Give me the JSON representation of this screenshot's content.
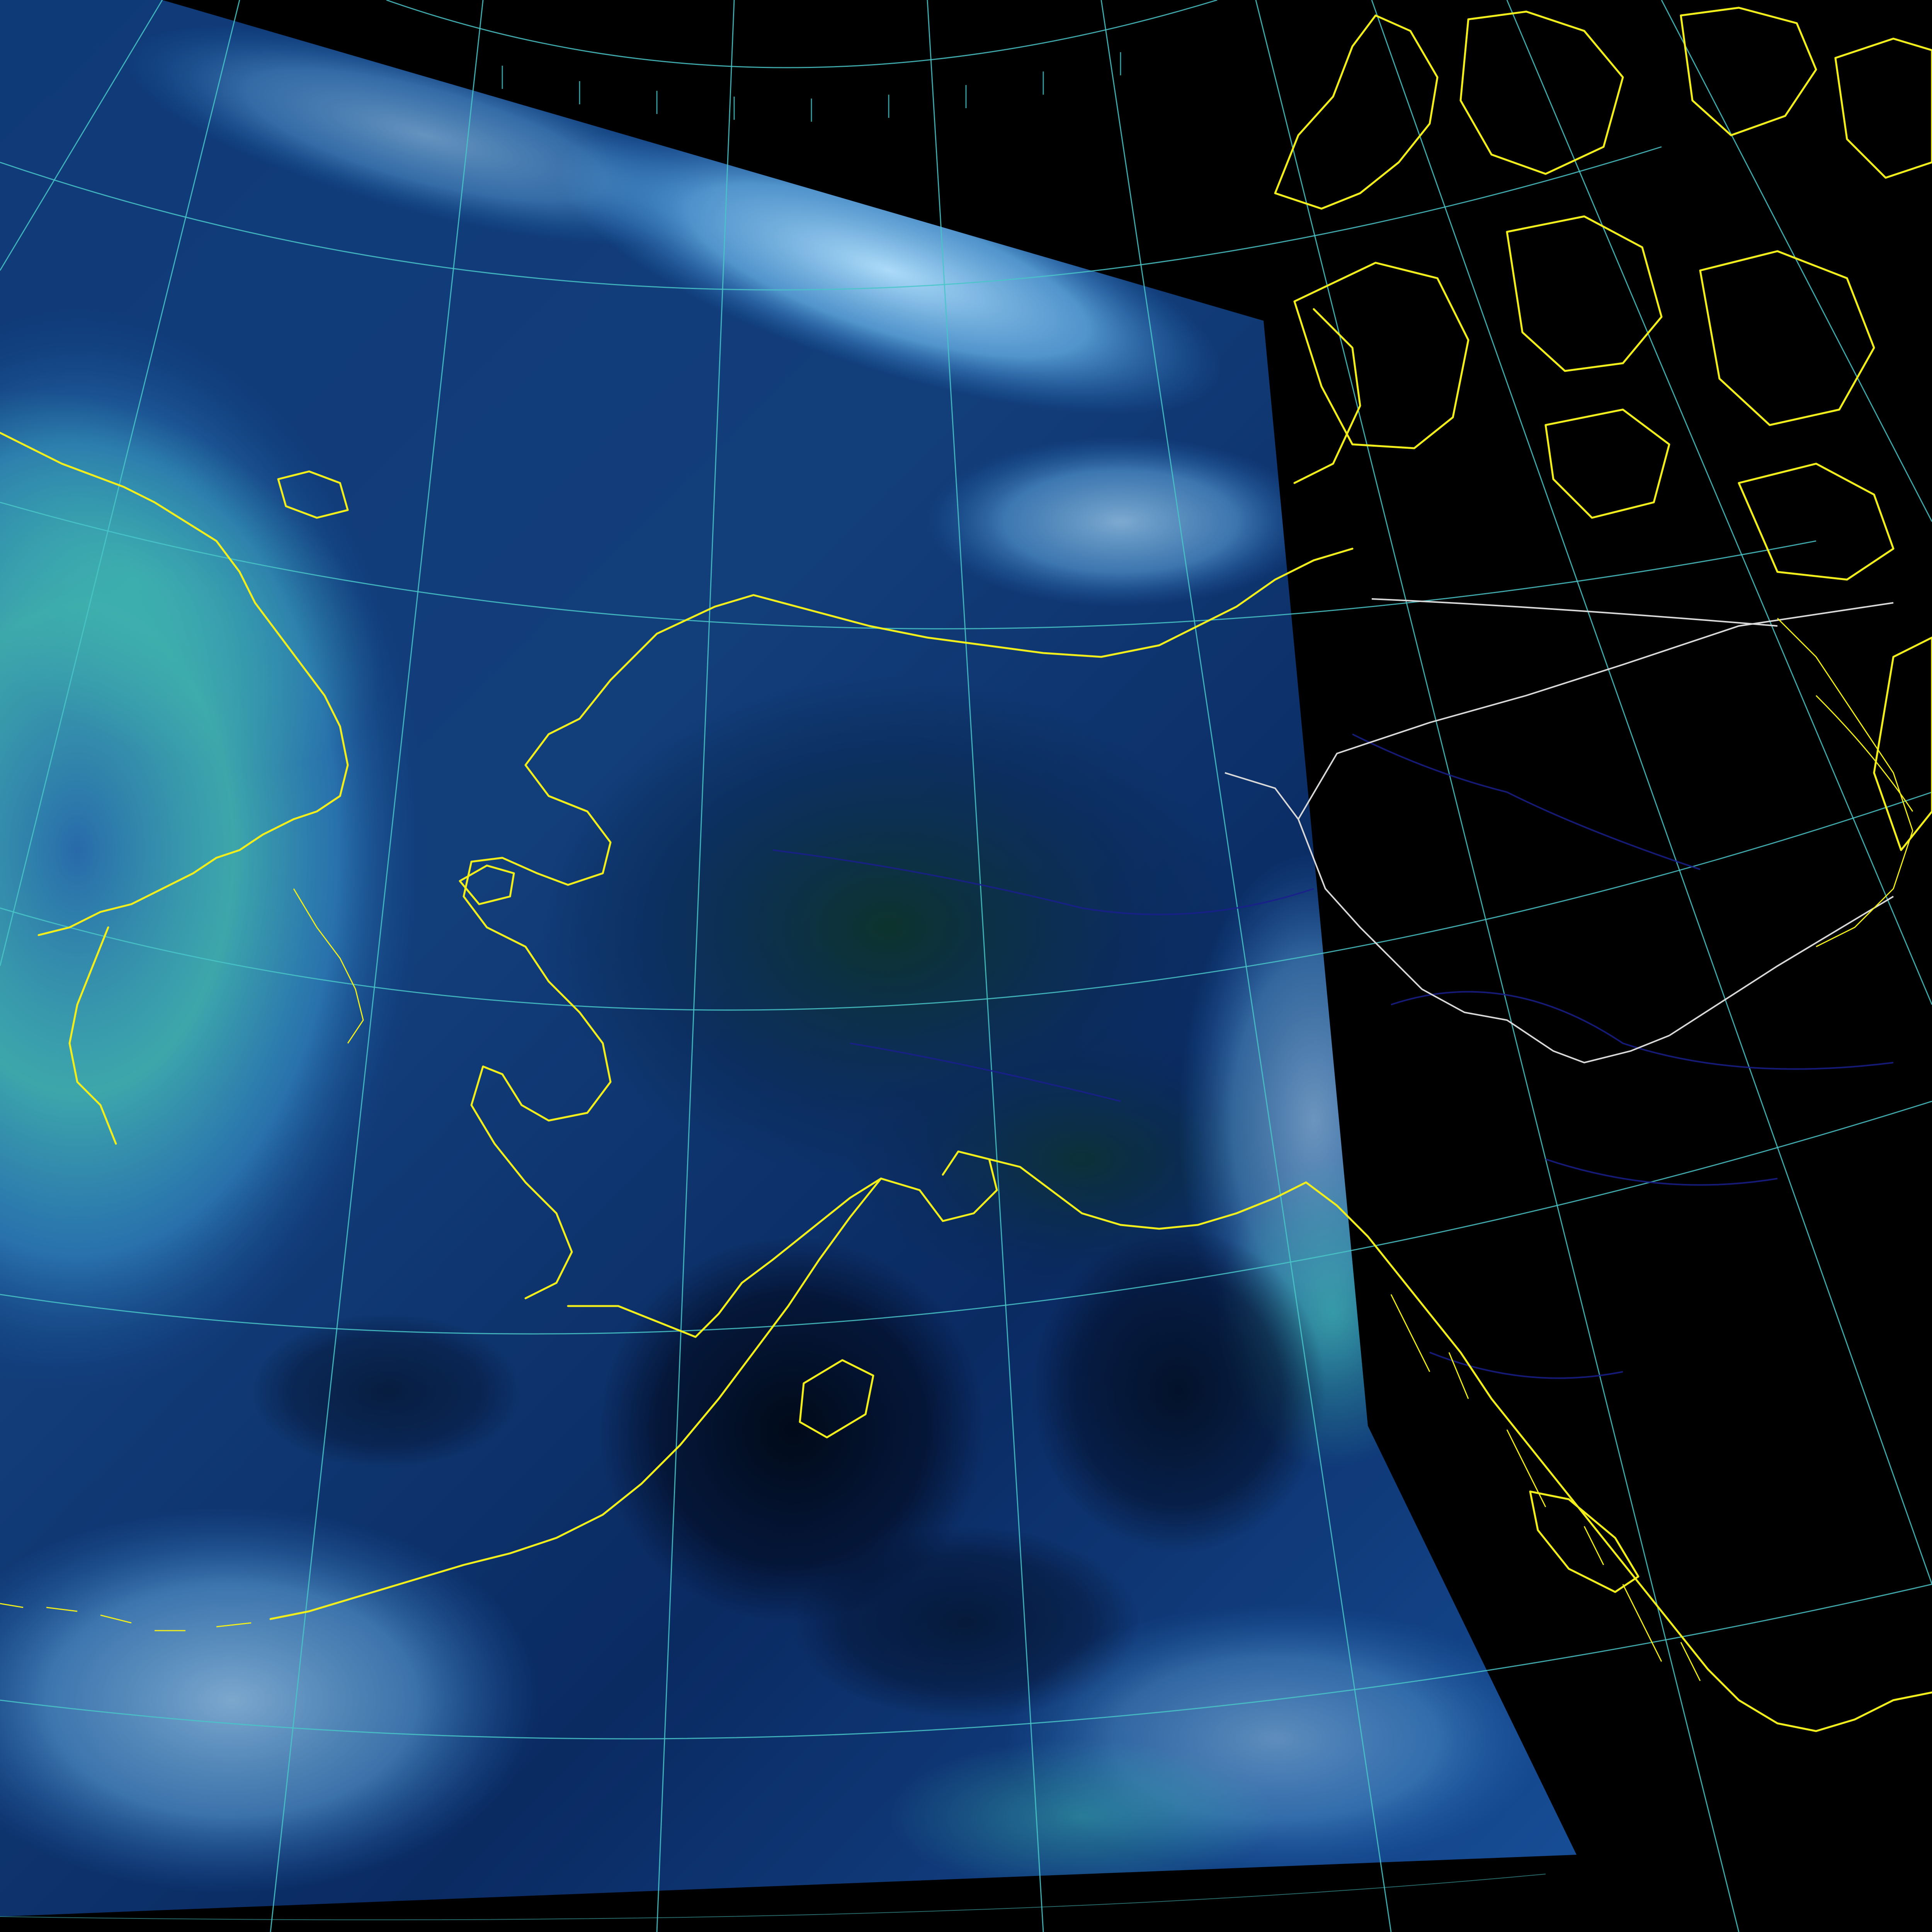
{
  "image": {
    "kind": "false-color satellite composite over map projection",
    "colors": {
      "background": "#000000",
      "coastline": "#f2ee1c",
      "graticule": "#49c6c8",
      "political_border": "#d8d8d8",
      "rivers": "#1a1f8c",
      "cloud_bright": "#9fd8ff",
      "cloud_mid": "#2f7fd0",
      "cloud_cyan": "#4fd3c0",
      "surface_dark": "#0b1f4a"
    }
  }
}
